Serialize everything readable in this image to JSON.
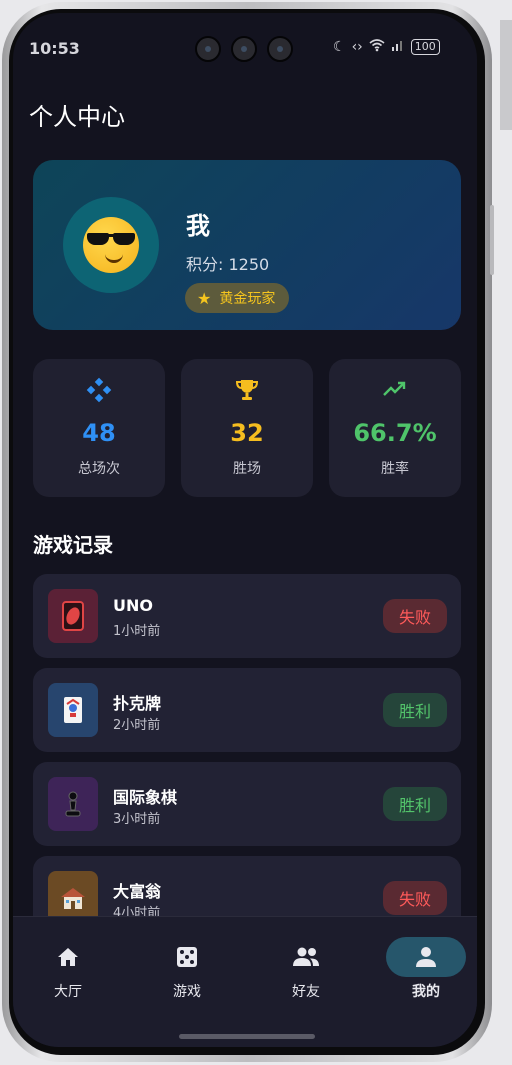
{
  "status_bar": {
    "time": "10:53",
    "battery": "100"
  },
  "header": {
    "title": "个人中心"
  },
  "profile": {
    "name": "我",
    "score": "积分: 1250",
    "rank": "黄金玩家"
  },
  "stats": [
    {
      "value": "48",
      "label": "总场次",
      "color": "#2f90f5",
      "icon": "gamepad-icon"
    },
    {
      "value": "32",
      "label": "胜场",
      "color": "#f5bd1f",
      "icon": "trophy-icon"
    },
    {
      "value": "66.7%",
      "label": "胜率",
      "color": "#4fc46a",
      "icon": "trending-up-icon"
    }
  ],
  "records_section": {
    "title": "游戏记录"
  },
  "records": [
    {
      "name": "UNO",
      "time": "1小时前",
      "result": "失败",
      "icon": "uno-card-icon",
      "icon_bg": "#5b2136"
    },
    {
      "name": "扑克牌",
      "time": "2小时前",
      "result": "胜利",
      "icon": "joker-card-icon",
      "icon_bg": "#27456e"
    },
    {
      "name": "国际象棋",
      "time": "3小时前",
      "result": "胜利",
      "icon": "chess-pawn-icon",
      "icon_bg": "#3e2458"
    },
    {
      "name": "大富翁",
      "time": "4小时前",
      "result": "失败",
      "icon": "house-icon",
      "icon_bg": "#6b4a24"
    }
  ],
  "nav": [
    {
      "label": "大厅",
      "icon": "home-icon"
    },
    {
      "label": "游戏",
      "icon": "dice-icon"
    },
    {
      "label": "好友",
      "icon": "friends-icon"
    },
    {
      "label": "我的",
      "icon": "person-icon",
      "active": true
    }
  ]
}
